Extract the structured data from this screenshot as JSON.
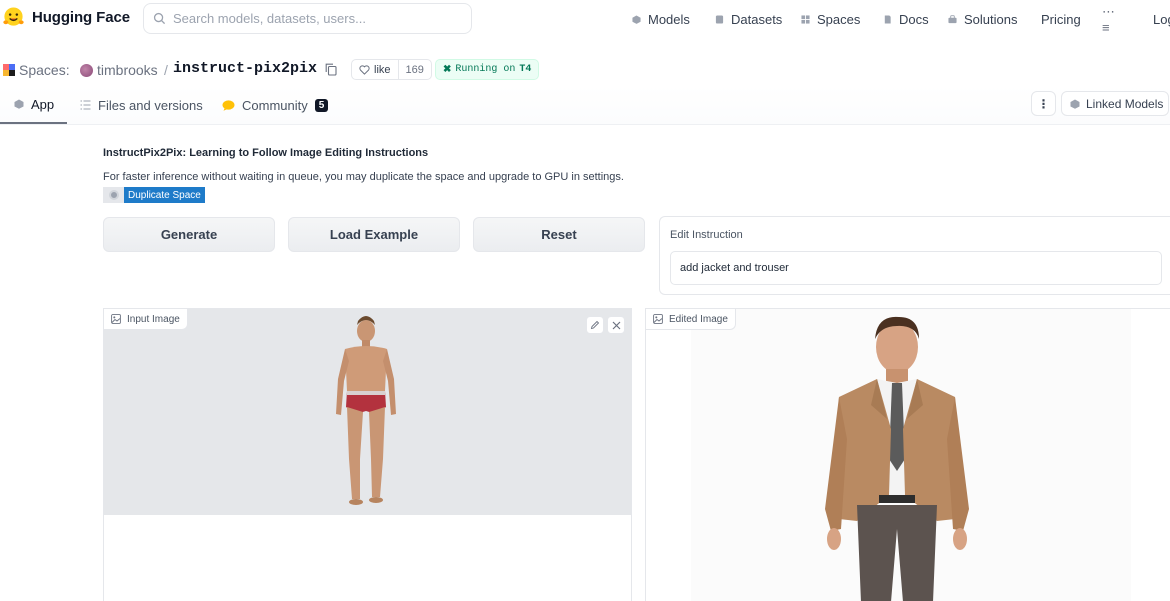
{
  "navbar": {
    "brand": "Hugging Face",
    "search_placeholder": "Search models, datasets, users...",
    "links": {
      "models": "Models",
      "datasets": "Datasets",
      "spaces": "Spaces",
      "docs": "Docs",
      "solutions": "Solutions",
      "pricing": "Pricing",
      "more": "⋯≡",
      "login": "Log"
    }
  },
  "space": {
    "section_label": "Spaces:",
    "owner": "timbrooks",
    "separator": "/",
    "repo": "instruct-pix2pix",
    "like_label": "like",
    "like_count": "169",
    "status": "Running on",
    "hardware": "T4"
  },
  "tabs": {
    "app": "App",
    "files": "Files and versions",
    "community": "Community",
    "community_count": "5",
    "more": "⋮",
    "linked_models": "Linked Models"
  },
  "app": {
    "title": "InstructPix2Pix: Learning to Follow Image Editing Instructions",
    "description": "For faster inference without waiting in queue, you may duplicate the space and upgrade to GPU in settings.",
    "duplicate_label": "Duplicate Space",
    "buttons": {
      "generate": "Generate",
      "load_example": "Load Example",
      "reset": "Reset"
    },
    "instruction": {
      "label": "Edit Instruction",
      "value": "add jacket and trouser"
    },
    "input_image_label": "Input Image",
    "edited_image_label": "Edited Image"
  },
  "colors": {
    "accent_blue": "#1e7bc9",
    "running_green": "#047857",
    "tab_active": "#6b7280"
  }
}
